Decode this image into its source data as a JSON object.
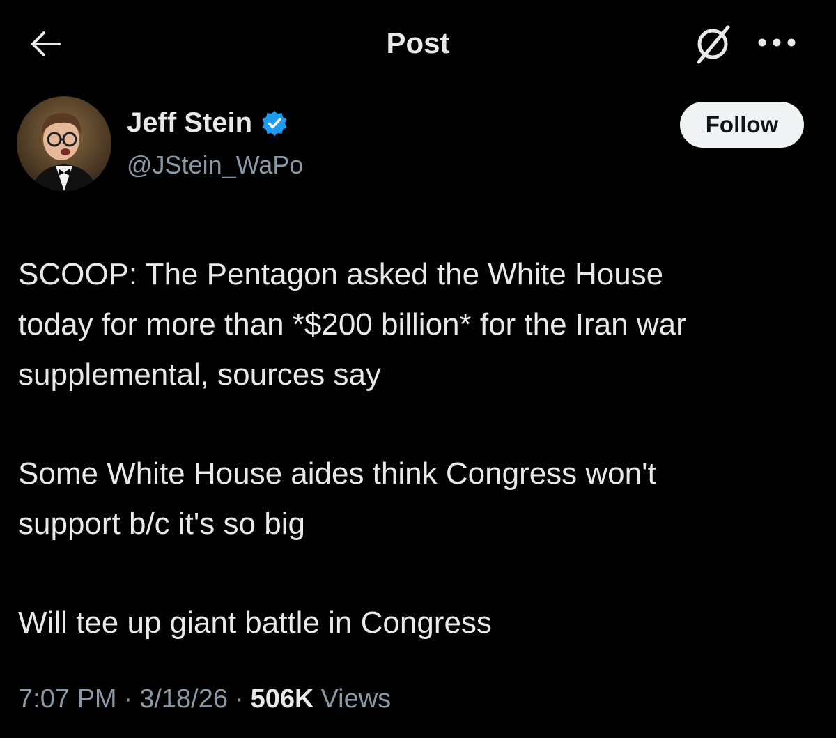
{
  "header": {
    "title": "Post",
    "back_icon": "arrow-left-icon",
    "grok_icon": "grok-icon",
    "more_icon": "more-horizontal-icon"
  },
  "author": {
    "display_name": "Jeff Stein",
    "handle": "@JStein_WaPo",
    "verified": true,
    "verified_icon": "verified-badge-icon",
    "follow_label": "Follow"
  },
  "post": {
    "paragraphs": [
      "SCOOP: The Pentagon asked the White House\ntoday for more than *$200 billion* for the Iran war\nsupplemental, sources say",
      "Some White House aides think Congress won't\nsupport b/c it's so big",
      "Will tee up giant battle in Congress"
    ]
  },
  "meta": {
    "time": "7:07 PM",
    "separator": "·",
    "date": "3/18/26",
    "views_count": "506K",
    "views_label": "Views"
  },
  "colors": {
    "background": "#000000",
    "text_primary": "#e7e9ea",
    "text_secondary": "#8b98a5",
    "verified": "#1d9bf0",
    "follow_bg": "#eff3f4"
  }
}
